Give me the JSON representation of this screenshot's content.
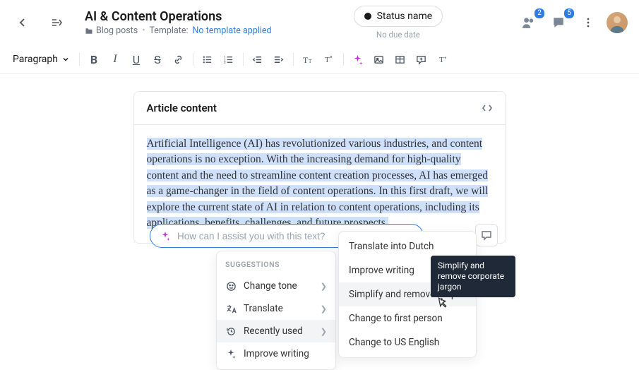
{
  "header": {
    "title": "AI & Content Operations",
    "folder": "Blog posts",
    "template_label": "Template:",
    "template_value": "No template applied",
    "status_name": "Status name",
    "due": "No due date",
    "badge_people": "2",
    "badge_comments": "5"
  },
  "toolbar": {
    "format": "Paragraph"
  },
  "card": {
    "title": "Article content",
    "body": "Artificial Intelligence (AI) has revolutionized various industries, and content operations is no exception. With the increasing demand for high-quality content and the need to streamline content creation processes, AI has emerged as a game-changer in the field of content operations. In this first draft, we will explore the current state of AI in relation to content operations, including its applications, benefits, challenges, and future prospects."
  },
  "assist": {
    "placeholder": "How can I assist you with this text?"
  },
  "suggestions": {
    "heading": "SUGGESTIONS",
    "items": [
      {
        "icon": "smile",
        "label": "Change tone",
        "sub": true
      },
      {
        "icon": "translate",
        "label": "Translate",
        "sub": true
      },
      {
        "icon": "history",
        "label": "Recently used",
        "sub": true
      },
      {
        "icon": "sparkle",
        "label": "Improve writing",
        "sub": false
      }
    ]
  },
  "recent": [
    "Translate into Dutch",
    "Improve writing",
    "Simplify and remove corporate...",
    "Change to first person",
    "Change to US English"
  ],
  "tooltip": "Simplify and remove corporate jargon"
}
